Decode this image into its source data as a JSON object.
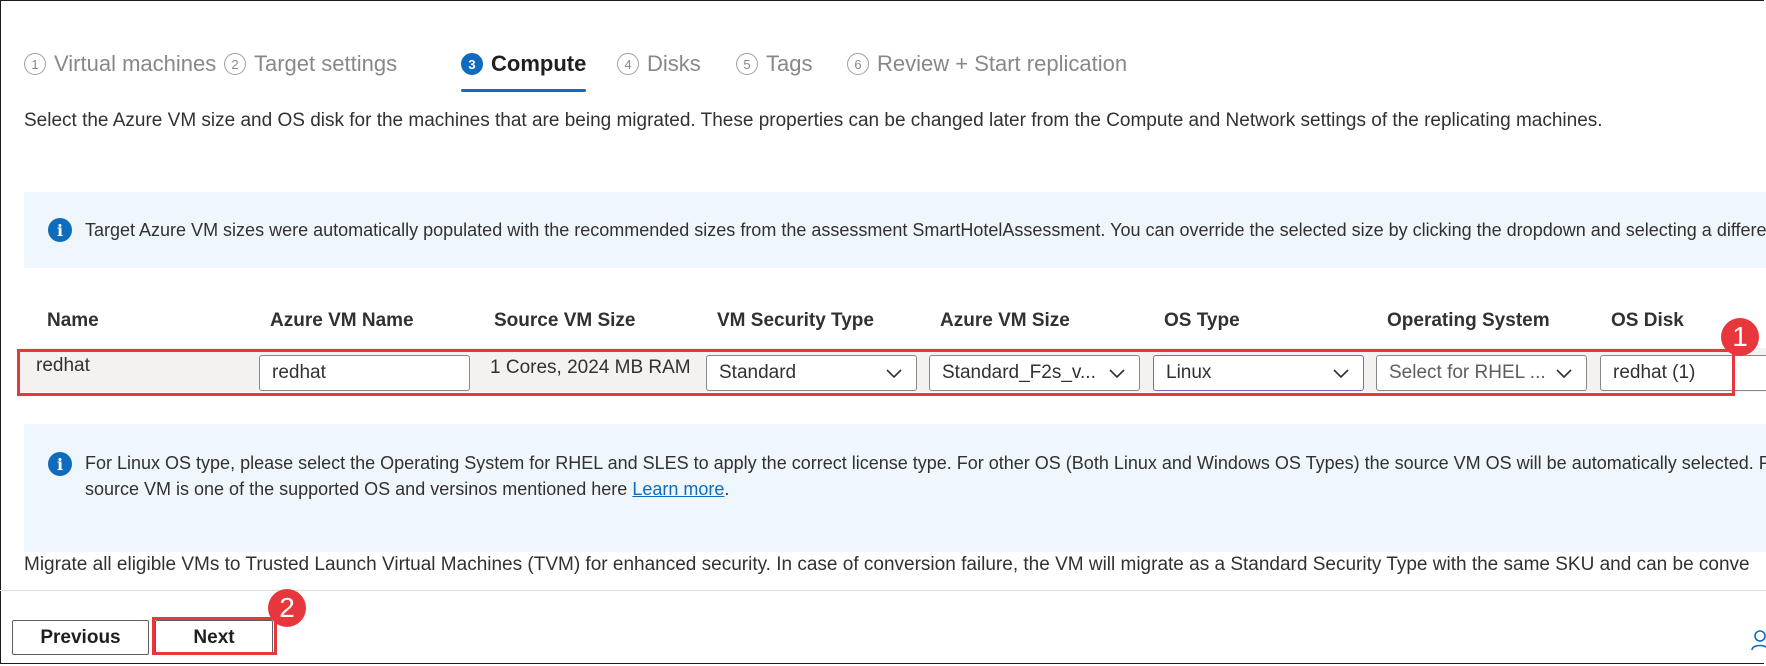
{
  "steps": [
    {
      "num": "1",
      "label": "Virtual machines"
    },
    {
      "num": "2",
      "label": "Target settings"
    },
    {
      "num": "3",
      "label": "Compute"
    },
    {
      "num": "4",
      "label": "Disks"
    },
    {
      "num": "5",
      "label": "Tags"
    },
    {
      "num": "6",
      "label": "Review + Start replication"
    }
  ],
  "active_step": "Compute",
  "description": "Select the Azure VM size and OS disk for the machines that are being migrated. These properties can be changed later from the Compute and Network settings of the replicating machines.",
  "info_size": "Target Azure VM sizes were automatically populated with the recommended sizes from the assessment SmartHotelAssessment. You can override the selected size by clicking the dropdown and selecting a different",
  "table": {
    "headers": [
      "Name",
      "Azure VM Name",
      "Source VM Size",
      "VM Security Type",
      "Azure VM Size",
      "OS Type",
      "Operating System",
      "OS Disk"
    ],
    "row": {
      "name": "redhat",
      "azure_vm_name": "redhat",
      "source_vm_size": "1 Cores, 2024 MB RAM",
      "vm_security_type": "Standard",
      "azure_vm_size": "Standard_F2s_v...",
      "os_type": "Linux",
      "operating_system_placeholder": "Select for RHEL ...",
      "os_disk": "redhat (1)"
    }
  },
  "info_os": {
    "line1": "For Linux OS type, please select the Operating System for RHEL and SLES to apply the correct license type. For other OS (Both Linux and Windows OS Types) the source VM OS will be automatically selected. Please",
    "line2_prefix": "source VM is one of the supported OS and versinos mentioned here ",
    "link": "Learn more",
    "line2_suffix": "."
  },
  "tvm_text": "Migrate all eligible VMs to Trusted Launch Virtual Machines (TVM) for enhanced security. In case of conversion failure, the VM will migrate as a Standard Security Type with the same SKU and can be conve",
  "buttons": {
    "previous": "Previous",
    "next": "Next"
  },
  "annotations": {
    "badge1": "1",
    "badge2": "2"
  },
  "colors": {
    "accent": "#0f6cbd",
    "highlight": "#e8363d",
    "info_bg": "#eff6fc",
    "focus_border": "#8764b8"
  },
  "icons": {
    "info": "info-icon",
    "chevron": "chevron-down-icon",
    "feedback": "person-feedback-icon"
  }
}
